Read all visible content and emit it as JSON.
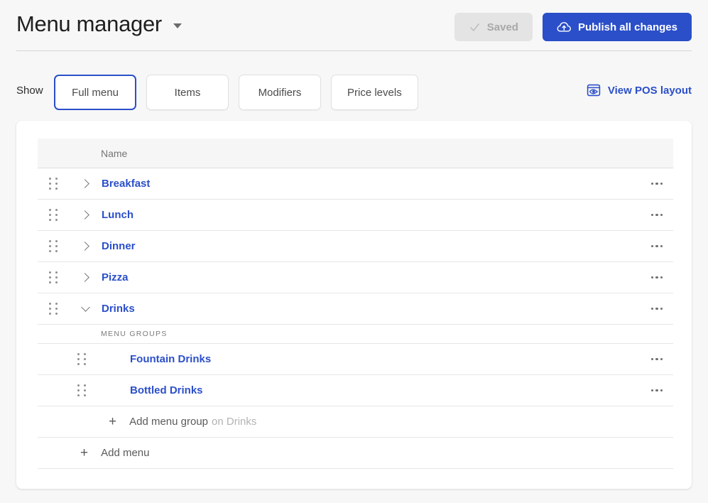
{
  "header": {
    "title": "Menu manager",
    "title_caret_icon": "chevron-down-icon",
    "saved_button": {
      "label": "Saved",
      "icon": "check-icon",
      "disabled": true,
      "bg_color": "#e4e4e4",
      "text_color": "#a8a8a8"
    },
    "publish_button": {
      "label": "Publish all changes",
      "icon": "cloud-upload-icon",
      "bg_color": "#2b4fc9",
      "text_color": "#ffffff"
    }
  },
  "show_row": {
    "label": "Show",
    "chips": [
      {
        "label": "Full menu",
        "selected": true
      },
      {
        "label": "Items",
        "selected": false
      },
      {
        "label": "Modifiers",
        "selected": false
      },
      {
        "label": "Price levels",
        "selected": false
      }
    ],
    "view_pos_layout": {
      "label": "View POS layout",
      "icon": "pos-preview-eye-icon",
      "color": "#2b4fc9"
    }
  },
  "table": {
    "columns": [
      "Name"
    ],
    "rows": [
      {
        "name": "Breakfast",
        "expanded": false,
        "overflow": "more-options"
      },
      {
        "name": "Lunch",
        "expanded": false,
        "overflow": "more-options"
      },
      {
        "name": "Dinner",
        "expanded": false,
        "overflow": "more-options"
      },
      {
        "name": "Pizza",
        "expanded": false,
        "overflow": "more-options"
      },
      {
        "name": "Drinks",
        "expanded": true,
        "overflow": "more-options"
      }
    ],
    "drinks_section": {
      "subheader": "MENU GROUPS",
      "groups": [
        {
          "name": "Fountain Drinks",
          "overflow": "more-options"
        },
        {
          "name": "Bottled Drinks",
          "overflow": "more-options"
        }
      ],
      "add_group": {
        "plus": "+",
        "label": "Add menu group",
        "context": "on Drinks"
      }
    },
    "add_menu": {
      "plus": "+",
      "label": "Add menu"
    }
  },
  "colors": {
    "page_background": "#f7f7f7",
    "card_background": "#ffffff",
    "accent_blue": "#2b4fc9",
    "link_blue": "#2b4fc9",
    "muted_text": "#757575"
  }
}
